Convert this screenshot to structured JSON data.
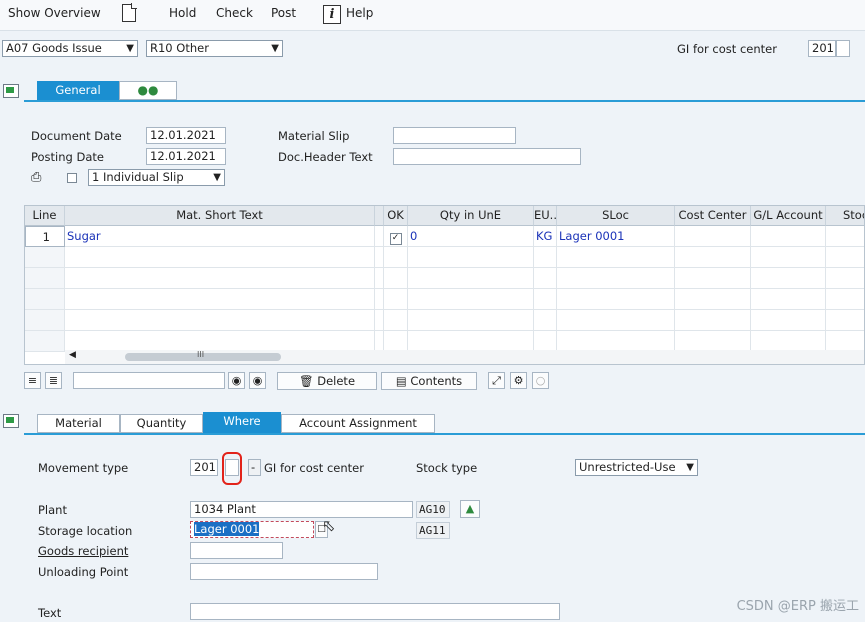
{
  "toolbar": {
    "show_overview": "Show Overview",
    "hold": "Hold",
    "check": "Check",
    "post": "Post",
    "help": "Help"
  },
  "header": {
    "transaction_select": "A07  Goods Issue",
    "reference_select": "R10  Other",
    "movement_label": "GI for cost center",
    "movement_code": "201"
  },
  "header_tabs": {
    "general": "General"
  },
  "general": {
    "document_date_label": "Document Date",
    "document_date": "12.01.2021",
    "posting_date_label": "Posting Date",
    "posting_date": "12.01.2021",
    "material_slip_label": "Material Slip",
    "material_slip": "",
    "doc_header_text_label": "Doc.Header Text",
    "doc_header_text": "",
    "print_option": "1  Individual Slip"
  },
  "items_table": {
    "columns": [
      "Line",
      "Mat. Short Text",
      "",
      "OK",
      "Qty in UnE",
      "EU..",
      "SLoc",
      "Cost Center",
      "G/L Account",
      "Stoc"
    ],
    "rows": [
      {
        "line": "1",
        "mat_short_text": "Sugar",
        "ok": true,
        "qty": "0",
        "eu": "KG",
        "sloc": "Lager 0001",
        "cost_center": "",
        "gl_account": ""
      }
    ],
    "scroll_marker": "III"
  },
  "table_toolbar": {
    "delete": "Delete",
    "contents": "Contents"
  },
  "detail_tabs": {
    "material": "Material",
    "quantity": "Quantity",
    "where": "Where",
    "account_assignment": "Account Assignment"
  },
  "where": {
    "movement_type_label": "Movement type",
    "movement_type": "201",
    "special_stock": "",
    "movement_sep": "-",
    "movement_desc": "GI for cost center",
    "stock_type_label": "Stock type",
    "stock_type": "Unrestricted-Use",
    "plant_label": "Plant",
    "plant": "1034 Plant",
    "plant_code": "AG10",
    "storage_location_label": "Storage location",
    "storage_location": "Lager 0001",
    "storage_code": "AG11",
    "goods_recipient_label": "Goods recipient",
    "goods_recipient": "",
    "unloading_point_label": "Unloading Point",
    "unloading_point": "",
    "text_label": "Text",
    "text": ""
  },
  "watermark": "CSDN @ERP 搬运工",
  "colors": {
    "accent": "#1b8fd1",
    "highlight_ring": "#e2231a",
    "link_blue": "#1a32b8"
  }
}
